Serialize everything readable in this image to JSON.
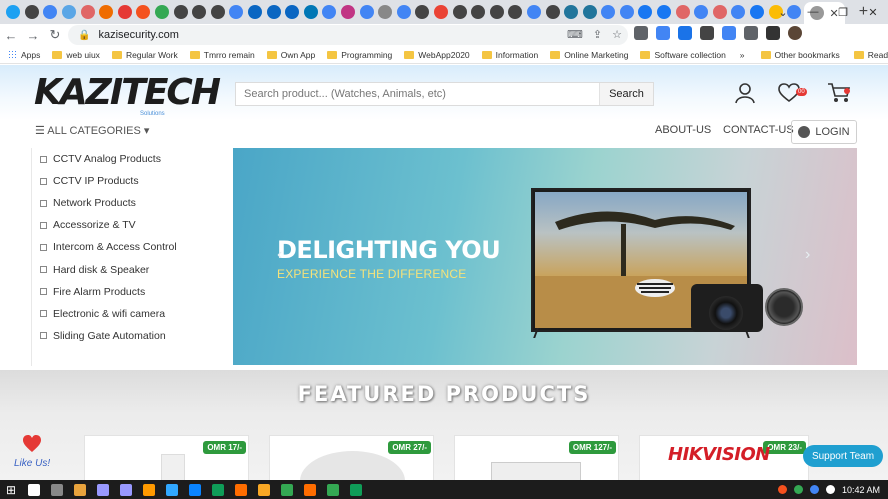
{
  "browser": {
    "tab_favicons": [
      "#1da1f2",
      "#444",
      "#4285f4",
      "#5aa6e6",
      "#e06666",
      "#ef6c00",
      "#e53935",
      "#f4511e",
      "#34a853",
      "#444",
      "#444",
      "#444",
      "#4285f4",
      "#0a66c2",
      "#0a66c2",
      "#0a66c2",
      "#0077b5",
      "#4285f4",
      "#c13584",
      "#4285f4",
      "#888",
      "#4285f4",
      "#444",
      "#ea4335",
      "#444",
      "#444",
      "#444",
      "#444",
      "#4285f4",
      "#444",
      "#21759b",
      "#21759b",
      "#4285f4",
      "#4285f4",
      "#1877f2",
      "#1877f2",
      "#e06666",
      "#4285f4",
      "#e06666",
      "#4285f4",
      "#1877f2",
      "#fbbc05",
      "#4285f4"
    ],
    "active_tab_favicon": "#999",
    "close_glyph": "✕",
    "new_tab_glyph": "+",
    "window_controls": [
      "⌄",
      "—",
      "❐",
      "✕"
    ],
    "url": "kazisecurity.com",
    "extension_colors": [
      "#5f6368",
      "#4285f4",
      "#1a73e8",
      "#444",
      "#4285f4",
      "#5f6368",
      "#333"
    ]
  },
  "bookmarks": [
    {
      "label": "Apps",
      "kind": "apps"
    },
    {
      "label": "web uiux",
      "kind": "folder"
    },
    {
      "label": "Regular Work",
      "kind": "folder"
    },
    {
      "label": "Tmrro remain",
      "kind": "folder"
    },
    {
      "label": "Own App",
      "kind": "folder"
    },
    {
      "label": "Programming",
      "kind": "folder"
    },
    {
      "label": "WebApp2020",
      "kind": "folder"
    },
    {
      "label": "Information",
      "kind": "folder"
    },
    {
      "label": "Online Marketing",
      "kind": "folder"
    },
    {
      "label": "Software collection",
      "kind": "folder"
    }
  ],
  "bookmarks_overflow": "»",
  "bookmarks_right": [
    "Other bookmarks",
    "Reading list"
  ],
  "site": {
    "logo_text": "KAZITECH",
    "logo_tagline": "Solutions",
    "search_placeholder": "Search product... (Watches, Animals, etc)",
    "search_button": "Search",
    "cart_count": "00",
    "all_categories": "☰ ALL CATEGORIES ▾",
    "nav_links": [
      "ABOUT-US",
      "CONTACT-US"
    ],
    "login_label": "LOGIN",
    "categories": [
      "CCTV Analog Products",
      "CCTV IP Products",
      "Network Products",
      "Accessorize & TV",
      "Intercom & Access Control",
      "Hard disk & Speaker",
      "Fire Alarm Products",
      "Electronic & wifi camera",
      "Sliding Gate Automation"
    ],
    "hero_title": "DELIGHTING YOU",
    "hero_subtitle": "EXPERIENCE THE DIFFERENCE",
    "hero_prev": "‹",
    "hero_next": "›",
    "featured_title": "FEATURED PRODUCTS",
    "products": [
      {
        "price": "OMR 17/-"
      },
      {
        "price": "OMR 27/-"
      },
      {
        "price": "OMR 127/-"
      },
      {
        "price": "OMR 23/-",
        "brand": "HIKVISION"
      }
    ],
    "like_us": "Like Us!",
    "support": "Support Team"
  },
  "taskbar": {
    "start_glyph": "⊞",
    "app_colors": [
      "#fff",
      "#888",
      "#e8a33d",
      "#9999ff",
      "#9999ff",
      "#ff9a00",
      "#31a8ff",
      "#0a84ff",
      "#0f9d58",
      "#ff6d00",
      "#f9a825",
      "#34a853",
      "#ff6d00",
      "#34a853",
      "#0f9d58"
    ],
    "clock": "10:42 AM",
    "tray_colors": [
      "#f4511e",
      "#34a853",
      "#4285f4",
      "#fff"
    ]
  }
}
